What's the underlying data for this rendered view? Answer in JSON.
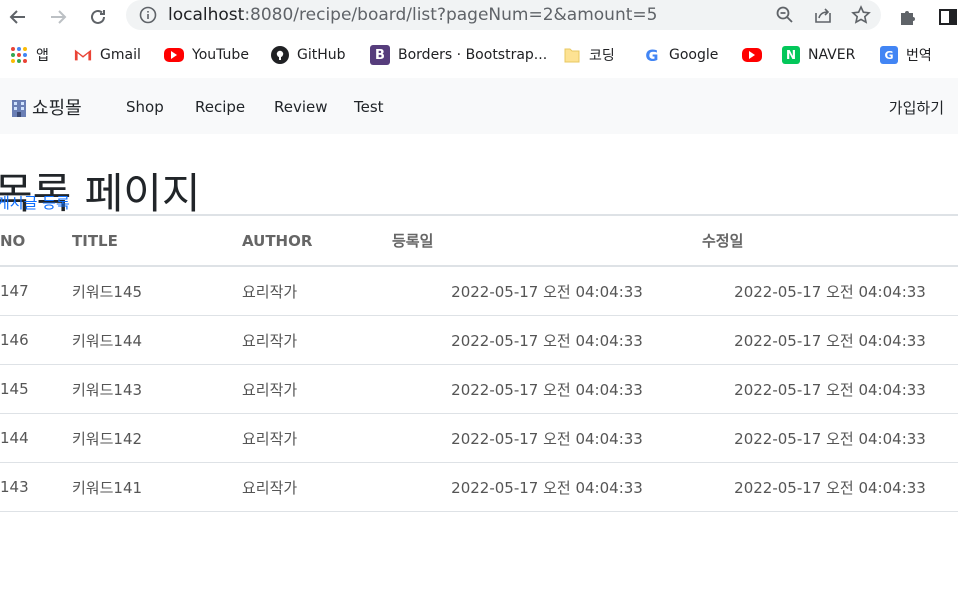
{
  "browser": {
    "url_host": "localhost",
    "url_rest": ":8080/recipe/board/list?pageNum=2&amount=5"
  },
  "bookmarks": [
    {
      "label": "앱",
      "icon": "apps-grid-icon"
    },
    {
      "label": "Gmail",
      "icon": "gmail-icon"
    },
    {
      "label": "YouTube",
      "icon": "youtube-icon"
    },
    {
      "label": "GitHub",
      "icon": "github-icon"
    },
    {
      "label": "Borders · Bootstrap...",
      "icon": "bootstrap-icon"
    },
    {
      "label": "코딩",
      "icon": "folder-icon"
    },
    {
      "label": "Google",
      "icon": "google-icon"
    },
    {
      "label": "",
      "icon": "youtube-icon"
    },
    {
      "label": "NAVER",
      "icon": "naver-icon"
    },
    {
      "label": "번역",
      "icon": "translate-icon"
    }
  ],
  "navbar": {
    "brand": "쇼핑몰",
    "links": [
      "Shop",
      "Recipe",
      "Review",
      "Test"
    ],
    "signup": "가입하기"
  },
  "page": {
    "title": "목록 페이지",
    "write_link": "게시글 등록"
  },
  "table": {
    "headers": [
      "NO",
      "TITLE",
      "AUTHOR",
      "등록일",
      "수정일"
    ],
    "rows": [
      {
        "no": "147",
        "title": "키워드145",
        "author": "요리작가",
        "reg": "2022-05-17 오전 04:04:33",
        "mod": "2022-05-17 오전 04:04:33"
      },
      {
        "no": "146",
        "title": "키워드144",
        "author": "요리작가",
        "reg": "2022-05-17 오전 04:04:33",
        "mod": "2022-05-17 오전 04:04:33"
      },
      {
        "no": "145",
        "title": "키워드143",
        "author": "요리작가",
        "reg": "2022-05-17 오전 04:04:33",
        "mod": "2022-05-17 오전 04:04:33"
      },
      {
        "no": "144",
        "title": "키워드142",
        "author": "요리작가",
        "reg": "2022-05-17 오전 04:04:33",
        "mod": "2022-05-17 오전 04:04:33"
      },
      {
        "no": "143",
        "title": "키워드141",
        "author": "요리작가",
        "reg": "2022-05-17 오전 04:04:33",
        "mod": "2022-05-17 오전 04:04:33"
      }
    ]
  },
  "colors": {
    "link": "#0d6efd",
    "navbar_bg": "#f8f9fa"
  }
}
